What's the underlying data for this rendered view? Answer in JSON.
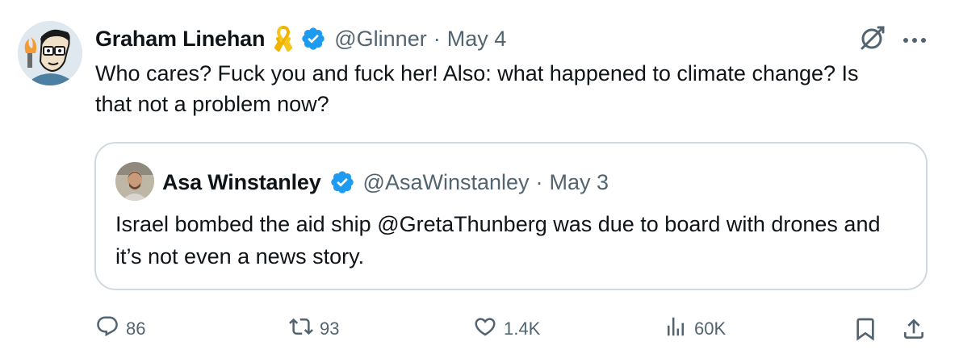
{
  "tweet": {
    "author": {
      "name": "Graham Linehan",
      "handle": "@Glinner",
      "date": "May 4",
      "separator": "·"
    },
    "text": "Who cares? Fuck you and fuck her! Also: what happened to climate change? Is that not a problem now?",
    "quoted": {
      "name": "Asa Winstanley",
      "handle": "@AsaWinstanley",
      "date": "May 3",
      "separator": "·",
      "text": "Israel bombed the aid ship @GretaThunberg was due to board with drones and it’s not even a news story."
    },
    "stats": {
      "replies": "86",
      "reposts": "93",
      "likes": "1.4K",
      "views": "60K"
    }
  },
  "colors": {
    "text": "#0f1419",
    "secondary": "#536471",
    "verified": "#1d9bf0",
    "ribbon": "#f5c518",
    "border": "#cfd9de"
  },
  "icons": {
    "ribbon": "yellow-ribbon-icon",
    "verified": "verified-badge-icon",
    "grok": "grok-icon",
    "more": "more-icon",
    "reply": "reply-icon",
    "repost": "repost-icon",
    "like": "like-icon",
    "views": "views-icon",
    "bookmark": "bookmark-icon",
    "share": "share-icon"
  }
}
